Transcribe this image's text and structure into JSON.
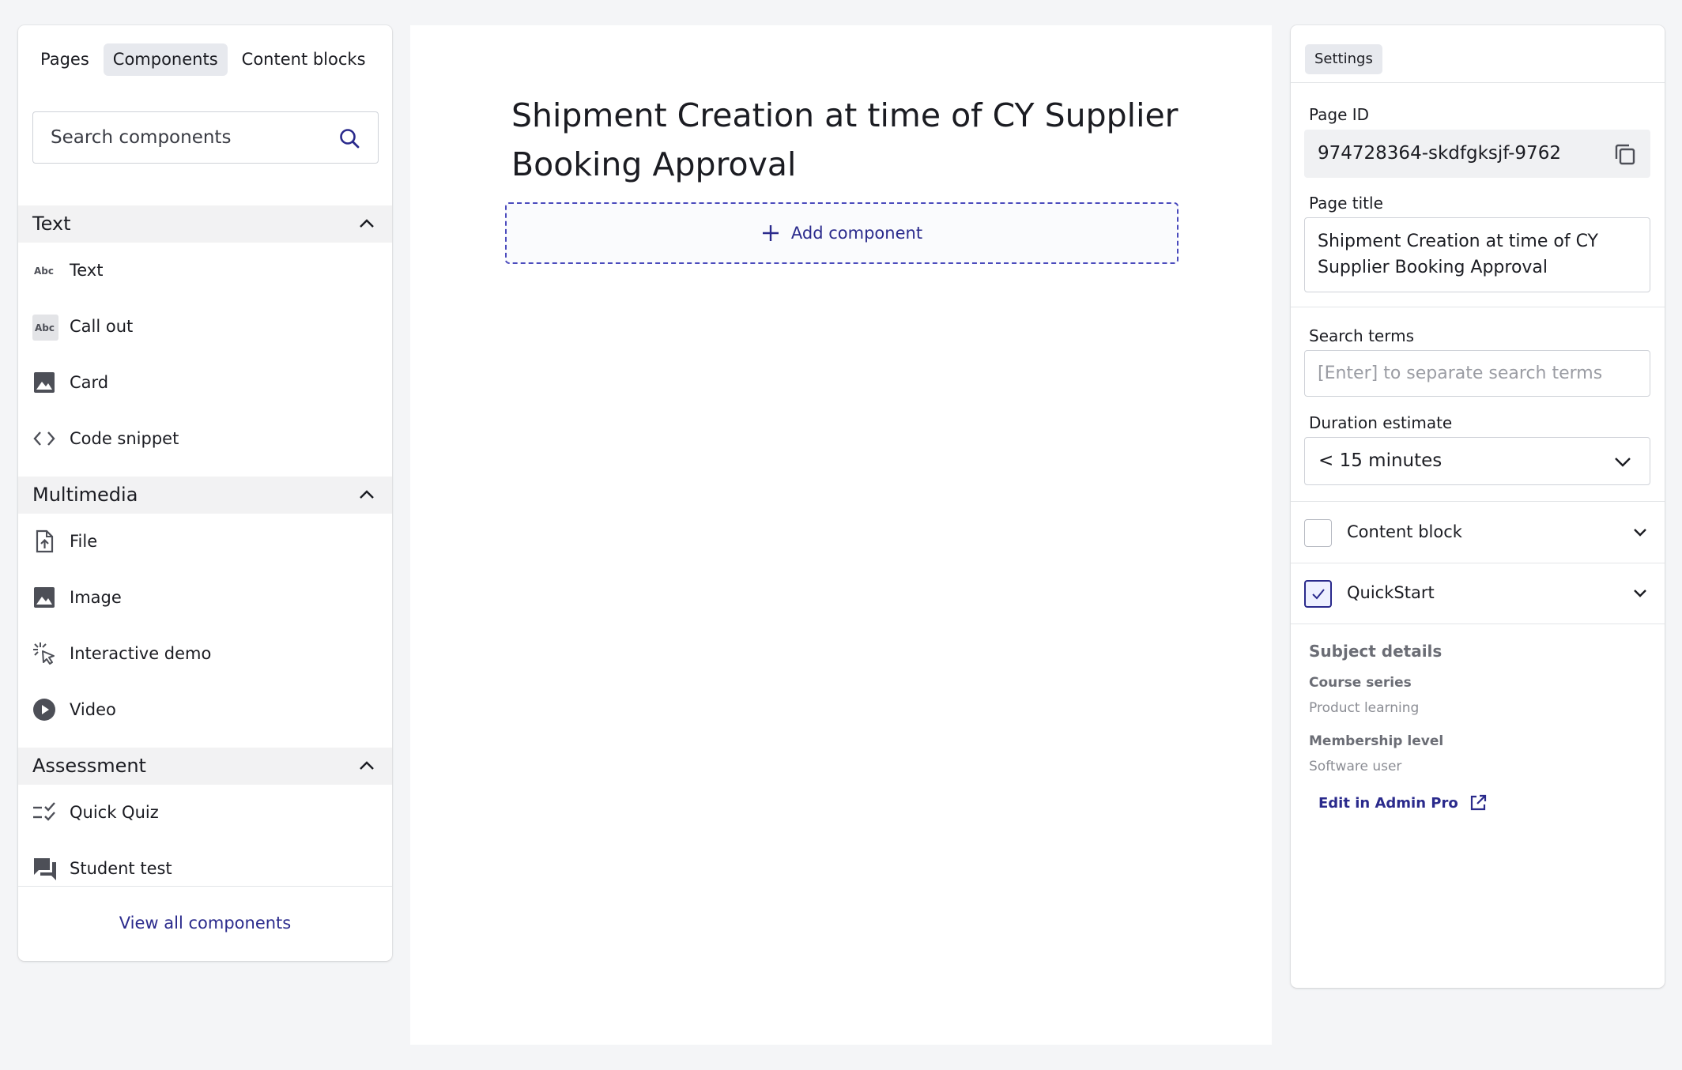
{
  "left_panel": {
    "tabs": [
      {
        "label": "Pages"
      },
      {
        "label": "Components"
      },
      {
        "label": "Content blocks"
      }
    ],
    "search": {
      "placeholder": "Search components",
      "value": ""
    },
    "sections": [
      {
        "title": "Text",
        "items": [
          {
            "label": "Text",
            "icon": "abc-icon"
          },
          {
            "label": "Call out",
            "icon": "abc-callout-icon"
          },
          {
            "label": "Card",
            "icon": "image-icon"
          },
          {
            "label": "Code snippet",
            "icon": "code-icon"
          }
        ]
      },
      {
        "title": "Multimedia",
        "items": [
          {
            "label": "File",
            "icon": "file-upload-icon"
          },
          {
            "label": "Image",
            "icon": "image-icon"
          },
          {
            "label": "Interactive demo",
            "icon": "cursor-click-icon"
          },
          {
            "label": "Video",
            "icon": "play-circle-icon"
          }
        ]
      },
      {
        "title": "Assessment",
        "items": [
          {
            "label": "Quick Quiz",
            "icon": "checklist-icon"
          },
          {
            "label": "Student test",
            "icon": "chat-bubbles-icon"
          }
        ]
      }
    ],
    "footer_link": "View all components"
  },
  "canvas": {
    "page_heading": "Shipment Creation at time of CY Supplier Booking Approval",
    "add_component_label": "Add component"
  },
  "right_panel": {
    "tab_label": "Settings",
    "page_id_label": "Page ID",
    "page_id_value": "974728364-skdfgksjf-9762",
    "page_title_label": "Page title",
    "page_title_value": "Shipment Creation at time of CY Supplier Booking Approval",
    "search_terms_label": "Search terms",
    "search_terms_placeholder": "[Enter] to separate search terms",
    "duration_label": "Duration estimate",
    "duration_value": "< 15 minutes",
    "content_block": {
      "label": "Content block",
      "checked": false
    },
    "quickstart": {
      "label": "QuickStart",
      "checked": true
    },
    "subject_details": {
      "title": "Subject details",
      "course_series_label": "Course series",
      "course_series_value": "Product learning",
      "membership_label": "Membership level",
      "membership_value": "Software user",
      "edit_link": "Edit in Admin Pro"
    }
  },
  "colors": {
    "accent": "#2a2a8c",
    "background": "#f4f5f7",
    "section_bg": "#f2f2f3",
    "icon_gray": "#4d4f57"
  }
}
